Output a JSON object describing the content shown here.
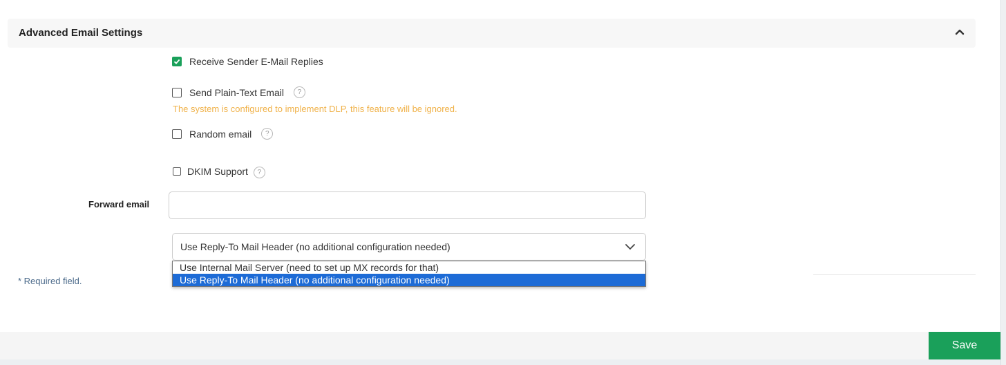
{
  "section": {
    "title": "Advanced Email Settings",
    "collapse_icon": "chevron-up-icon"
  },
  "options": {
    "receive_replies": {
      "label": "Receive Sender E-Mail Replies",
      "checked": true
    },
    "plain_text": {
      "label": "Send Plain-Text Email",
      "checked": false,
      "help": "?"
    },
    "dlp_warning": "The system is configured to implement DLP, this feature will be ignored.",
    "random_email": {
      "label": "Random email",
      "checked": false,
      "help": "?"
    },
    "dkim": {
      "label": "DKIM Support",
      "checked": false,
      "help": "?"
    }
  },
  "forward_email": {
    "label": "Forward email",
    "value": ""
  },
  "reply_method": {
    "selected": "Use Reply-To Mail Header (no additional configuration needed)",
    "options": [
      "Use Internal Mail Server (need to set up MX records for that)",
      "Use Reply-To Mail Header (no additional configuration needed)"
    ],
    "selected_index": 1
  },
  "required_note": "* Required field.",
  "footer": {
    "save_label": "Save"
  },
  "colors": {
    "accent_green": "#1aa05a",
    "warning": "#f0b24a",
    "selection_blue": "#1d6bd6"
  }
}
